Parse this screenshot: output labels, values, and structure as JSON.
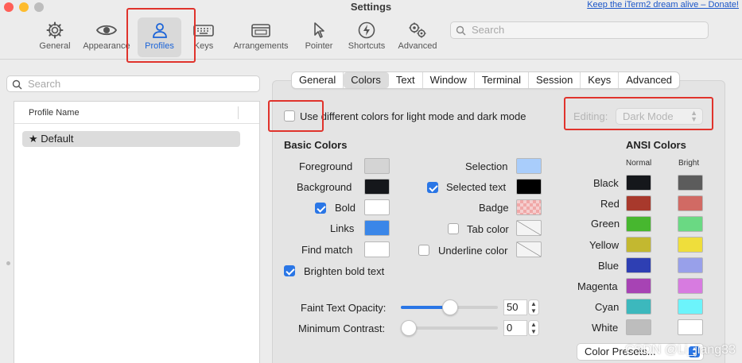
{
  "window": {
    "title": "Settings",
    "promo_link": "Keep the iTerm2 dream alive – Donate!"
  },
  "toolbar": {
    "items": [
      {
        "label": "General",
        "icon": "gear-icon"
      },
      {
        "label": "Appearance",
        "icon": "eye-icon"
      },
      {
        "label": "Profiles",
        "icon": "person-icon",
        "selected": true
      },
      {
        "label": "Keys",
        "icon": "keyboard-icon"
      },
      {
        "label": "Arrangements",
        "icon": "window-stack-icon"
      },
      {
        "label": "Pointer",
        "icon": "pointer-icon"
      },
      {
        "label": "Shortcuts",
        "icon": "bolt-icon"
      },
      {
        "label": "Advanced",
        "icon": "gears-icon"
      }
    ],
    "search_placeholder": "Search"
  },
  "sidebar": {
    "search_placeholder": "Search",
    "column_header": "Profile Name",
    "profiles": [
      {
        "name": "Default",
        "default": true
      }
    ]
  },
  "tabs": [
    {
      "label": "General"
    },
    {
      "label": "Colors",
      "active": true
    },
    {
      "label": "Text"
    },
    {
      "label": "Window"
    },
    {
      "label": "Terminal"
    },
    {
      "label": "Session"
    },
    {
      "label": "Keys"
    },
    {
      "label": "Advanced"
    }
  ],
  "colors_pane": {
    "mode_checkbox": {
      "label": "Use different colors for light mode and dark mode",
      "checked": false
    },
    "editing": {
      "label": "Editing:",
      "value": "Dark Mode"
    },
    "basic_title": "Basic Colors",
    "foreground": {
      "label": "Foreground",
      "color": "#d4d4d4"
    },
    "background": {
      "label": "Background",
      "color": "#15171b"
    },
    "bold": {
      "label": "Bold",
      "checked": true,
      "color": "#ffffff"
    },
    "links": {
      "label": "Links",
      "color": "#3a86e8"
    },
    "find_match": {
      "label": "Find match",
      "color": "#ffffff"
    },
    "selection": {
      "label": "Selection",
      "color": "#a9cdfb"
    },
    "selected_text": {
      "label": "Selected text",
      "checked": true,
      "color": "#000000"
    },
    "badge": {
      "label": "Badge"
    },
    "tab_color": {
      "label": "Tab color",
      "checked": false
    },
    "underline_color": {
      "label": "Underline color",
      "checked": false
    },
    "brighten_bold": {
      "label": "Brighten bold text",
      "checked": true
    },
    "faint_opacity": {
      "label": "Faint Text Opacity:",
      "value": "50"
    },
    "min_contrast": {
      "label": "Minimum Contrast:",
      "value": "0"
    },
    "ansi_title": "ANSI Colors",
    "ansi_col_normal": "Normal",
    "ansi_col_bright": "Bright",
    "ansi": [
      {
        "name": "Black",
        "normal": "#15171b",
        "bright": "#5c5c5c"
      },
      {
        "name": "Red",
        "normal": "#a8392c",
        "bright": "#d16a64"
      },
      {
        "name": "Green",
        "normal": "#47b72f",
        "bright": "#6ad983"
      },
      {
        "name": "Yellow",
        "normal": "#c3b830",
        "bright": "#efde3b"
      },
      {
        "name": "Blue",
        "normal": "#2e3fb3",
        "bright": "#98a0ea"
      },
      {
        "name": "Magenta",
        "normal": "#a743b4",
        "bright": "#d77be0"
      },
      {
        "name": "Cyan",
        "normal": "#3cb8bd",
        "bright": "#6cf4fb"
      },
      {
        "name": "White",
        "normal": "#bdbdbd",
        "bright": "#ffffff"
      }
    ],
    "presets_button": "Color Presets..."
  },
  "watermark": "CSDN @Li_jiang33"
}
